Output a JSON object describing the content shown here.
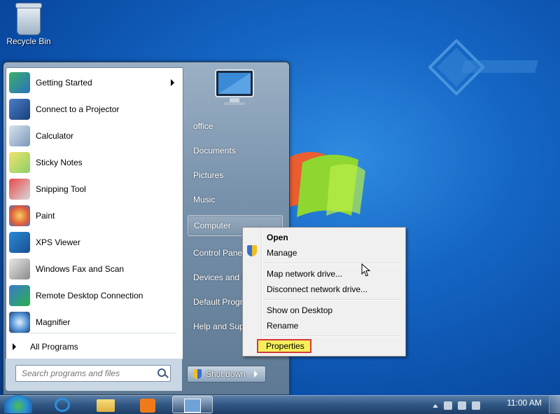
{
  "desktop": {
    "recycle_bin_label": "Recycle Bin"
  },
  "colors": {
    "desktop_blue": "#1566c4",
    "highlight_yellow": "#f5ef5a",
    "highlight_border": "#d63a3a"
  },
  "start_menu": {
    "programs": [
      {
        "label": "Getting Started",
        "icon": "getting-started-icon",
        "submenu": true
      },
      {
        "label": "Connect to a Projector",
        "icon": "projector-icon"
      },
      {
        "label": "Calculator",
        "icon": "calculator-icon"
      },
      {
        "label": "Sticky Notes",
        "icon": "sticky-notes-icon"
      },
      {
        "label": "Snipping Tool",
        "icon": "snipping-tool-icon"
      },
      {
        "label": "Paint",
        "icon": "paint-icon"
      },
      {
        "label": "XPS Viewer",
        "icon": "xps-viewer-icon"
      },
      {
        "label": "Windows Fax and Scan",
        "icon": "fax-scan-icon"
      },
      {
        "label": "Remote Desktop Connection",
        "icon": "remote-desktop-icon"
      },
      {
        "label": "Magnifier",
        "icon": "magnifier-icon"
      }
    ],
    "all_programs": "All Programs",
    "search_placeholder": "Search programs and files",
    "right_items": [
      {
        "label": "office"
      },
      {
        "label": "Documents"
      },
      {
        "label": "Pictures"
      },
      {
        "label": "Music"
      },
      {
        "label": "Computer",
        "highlighted": true
      },
      {
        "label": "Control Pane"
      },
      {
        "label": "Devices and P"
      },
      {
        "label": "Default Progr"
      },
      {
        "label": "Help and Sup"
      }
    ],
    "shutdown_label": "Shut down"
  },
  "context_menu": {
    "items": [
      {
        "label": "Open",
        "bold": true
      },
      {
        "label": "Manage",
        "icon": "uac-shield-icon"
      },
      {
        "label": "Map network drive..."
      },
      {
        "label": "Disconnect network drive..."
      },
      {
        "label": "Show on Desktop"
      },
      {
        "label": "Rename"
      },
      {
        "label": "Properties",
        "highlighted": true
      }
    ]
  },
  "taskbar": {
    "clock_time": "11:00 AM"
  }
}
